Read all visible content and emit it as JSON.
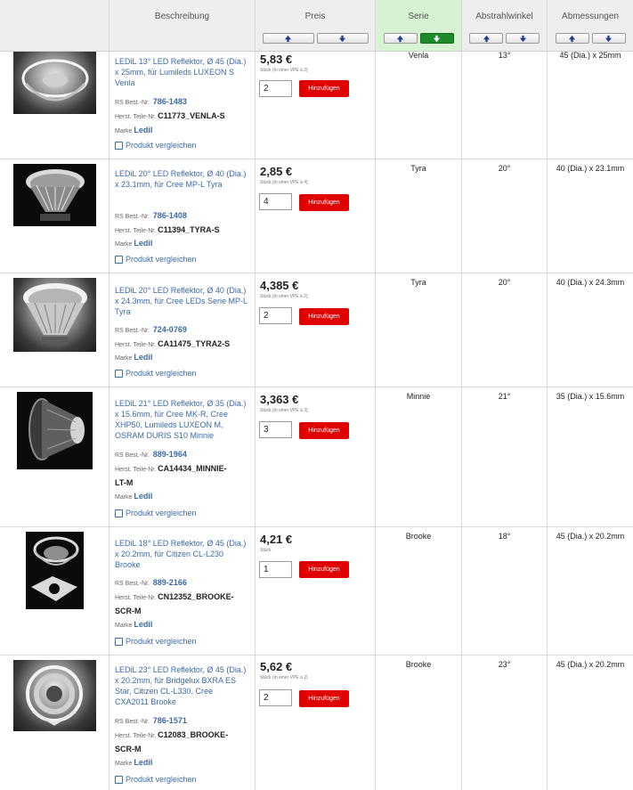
{
  "header": {
    "columns": {
      "beschreibung": "Beschreibung",
      "preis": "Preis",
      "serie": "Serie",
      "abstrahlwinkel": "Abstrahlwinkel",
      "abmessungen": "Abmessungen"
    },
    "active_sort": "serie-desc"
  },
  "labels": {
    "rs_best_nr": "RS Best.-Nr.",
    "herst_teile_nr": "Herst. Teile-Nr.",
    "marke": "Marke",
    "compare": "Produkt vergleichen",
    "add": "Hinzufügen"
  },
  "products": [
    {
      "description": "LEDiL 13° LED Reflektor, Ø 45 (Dia.) x 25mm, für Lumileds LUXEON S Venla",
      "rs_number": "786-1483",
      "mfr_part": "C11773_VENLA-S",
      "brand": "Ledil",
      "price": "5,83 €",
      "unit": "Stück (In einer VPE à 2)",
      "quantity": "2",
      "serie": "Venla",
      "angle": "13°",
      "dimensions": "45 (Dia.) x 25mm"
    },
    {
      "description": "LEDiL 20° LED Reflektor, Ø 40 (Dia.) x 23.1mm, für Cree MP-L Tyra",
      "rs_number": "786-1408",
      "mfr_part": "C11394_TYRA-S",
      "brand": "Ledil",
      "price": "2,85 €",
      "unit": "Stück (In einer VPE à 4)",
      "quantity": "4",
      "serie": "Tyra",
      "angle": "20°",
      "dimensions": "40 (Dia.) x 23.1mm"
    },
    {
      "description": "LEDiL 20° LED Reflektor, Ø 40 (Dia.) x 24.3mm, für Cree LEDs Serie MP-L Tyra",
      "rs_number": "724-0769",
      "mfr_part": "CA11475_TYRA2-S",
      "brand": "Ledil",
      "price": "4,385 €",
      "unit": "Stück (In einer VPE à 2)",
      "quantity": "2",
      "serie": "Tyra",
      "angle": "20°",
      "dimensions": "40 (Dia.) x 24.3mm"
    },
    {
      "description": "LEDiL 21° LED Reflektor, Ø 35 (Dia.) x 15.6mm, für Cree MK-R, Cree XHP50, Lumileds LUXEON M, OSRAM DURIS S10 Minnie",
      "rs_number": "889-1964",
      "mfr_part_line1": "CA14434_MINNIE-",
      "mfr_part_line2": "LT-M",
      "brand": "Ledil",
      "price": "3,363 €",
      "unit": "Stück (In einer VPE à 3)",
      "quantity": "3",
      "serie": "Minnie",
      "angle": "21°",
      "dimensions": "35 (Dia.) x 15.6mm"
    },
    {
      "description": "LEDiL 18° LED Reflektor, Ø 45 (Dia.) x 20.2mm, für Citizen CL-L230 Brooke",
      "rs_number": "889-2166",
      "mfr_part_line1": "CN12352_BROOKE-",
      "mfr_part_line2": "SCR-M",
      "brand": "Ledil",
      "price": "4,21 €",
      "unit": "Stück",
      "quantity": "1",
      "serie": "Brooke",
      "angle": "18°",
      "dimensions": "45 (Dia.) x 20.2mm"
    },
    {
      "description": "LEDiL 23° LED Reflektor, Ø 45 (Dia.) x 20.2mm, für Bridgelux BXRA ES Star, Citizen CL-L330, Cree CXA2011 Brooke",
      "rs_number": "786-1571",
      "mfr_part_line1": "C12083_BROOKE-",
      "mfr_part_line2": "SCR-M",
      "brand": "Ledil",
      "price": "5,62 €",
      "unit": "Stück (In einer VPE à 2)",
      "quantity": "2",
      "serie": "Brooke",
      "angle": "23°",
      "dimensions": "45 (Dia.) x 20.2mm"
    }
  ],
  "colors": {
    "link": "#3b6aa8",
    "add_button": "#e00000",
    "active_header": "#d6f2d3",
    "active_sort_button": "#1f8a2a"
  }
}
